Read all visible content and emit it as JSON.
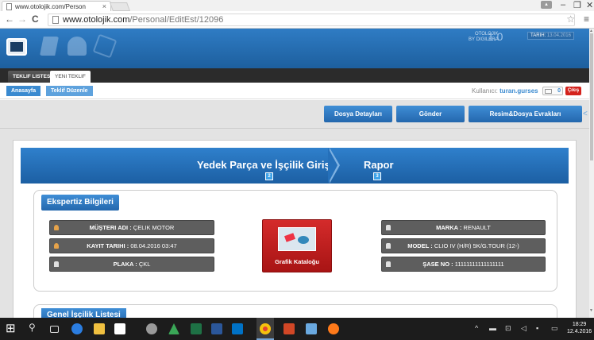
{
  "browser": {
    "tab_title": "www.otolojik.com/Person",
    "tab_close": "×",
    "url_host": "www.otolojik.com",
    "url_path": "/Personal/EditEst/12096",
    "win_minimize": "–",
    "win_restore": "❐",
    "win_close": "✕",
    "back": "←",
    "forward": "→",
    "reload": "C",
    "star": "☆",
    "menu": "≡"
  },
  "app": {
    "brand_line1": "OTOLOJIK",
    "brand_line2": "BY DIGILERA",
    "version": "1.0",
    "date_label": "TARIH:",
    "date_value": "13.04.2016",
    "tabs": {
      "list": "TEKLIF LISTESI",
      "new": "YENI TEKLIF"
    },
    "breadcrumb": {
      "home": "Anasayfa",
      "current": "Teklif Düzenle"
    },
    "user_prefix": "Kullanıcı:",
    "user_name": "turan.gurses",
    "mail_count": "0",
    "logout": "Çıkış"
  },
  "actions": {
    "details": "Dosya Detayları",
    "send": "Gönder",
    "files": "Resim&Dosya Evrakları",
    "side_arrow": "<"
  },
  "wizard": {
    "step2_title": "Yedek Parça ve İşçilik Girişi",
    "step2_num": "2",
    "step3_title": "Rapor",
    "step3_num": "3"
  },
  "expertise": {
    "legend": "Ekspertiz Bilgileri",
    "customer_label": "MÜŞTERI ADI :",
    "customer_value": "ÇELIK MOTOR",
    "record_label": "KAYIT TARIHI :",
    "record_value": "08.04.2016 03:47",
    "plate_label": "PLAKA :",
    "plate_value": "ÇKL",
    "brand_label": "MARKA :",
    "brand_value": "RENAULT",
    "model_label": "MODEL :",
    "model_value": "CLIO IV (H/R) 5K/G.TOUR (12-)",
    "chassis_label": "ŞASE NO :",
    "chassis_value": "11111111111111111",
    "catalog_button": "Grafik Kataloğu"
  },
  "labour": {
    "legend": "Genel İşçilik Listesi"
  },
  "taskbar": {
    "clock_time": "18:29",
    "clock_date": "12.4.2016"
  }
}
